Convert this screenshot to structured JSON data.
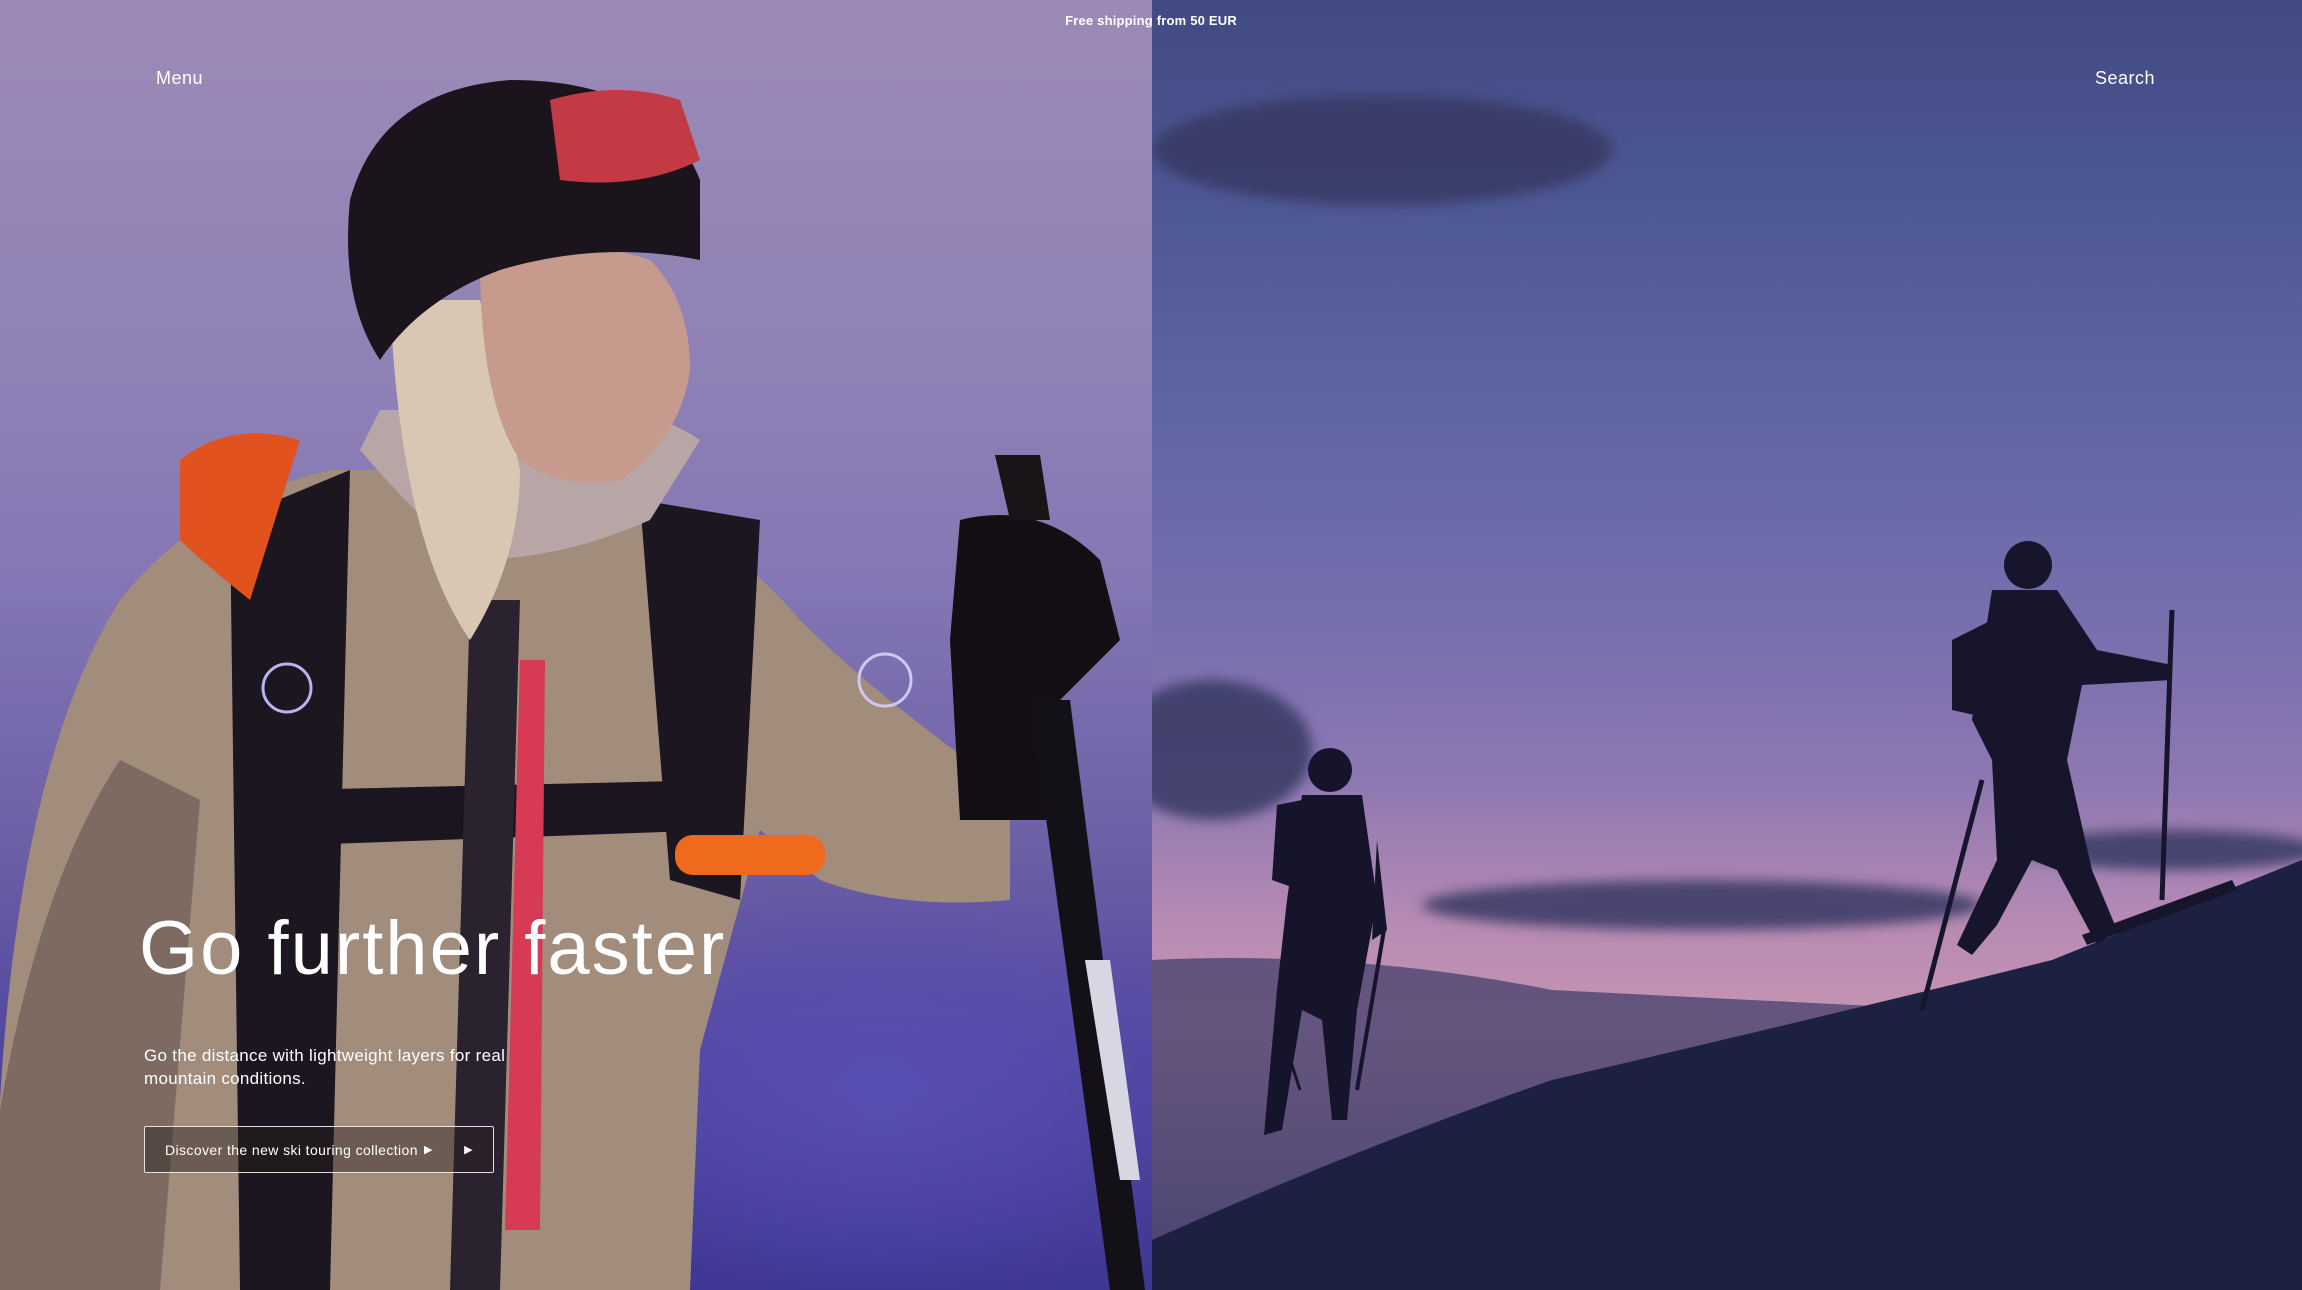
{
  "promo": {
    "text": "Free shipping from 50 EUR"
  },
  "header": {
    "menu_label": "Menu",
    "search_label": "Search"
  },
  "hero": {
    "title": "Go further faster",
    "subtitle": "Go the distance with lightweight layers for real mountain conditions.",
    "cta_label": "Discover the new ski touring collection",
    "cta_icon": "play-arrow-icon"
  },
  "colors": {
    "left_sky": "#8f82b6",
    "right_sky": "#5f66a3",
    "horizon_pink": "#c995b2",
    "text": "#ffffff"
  }
}
